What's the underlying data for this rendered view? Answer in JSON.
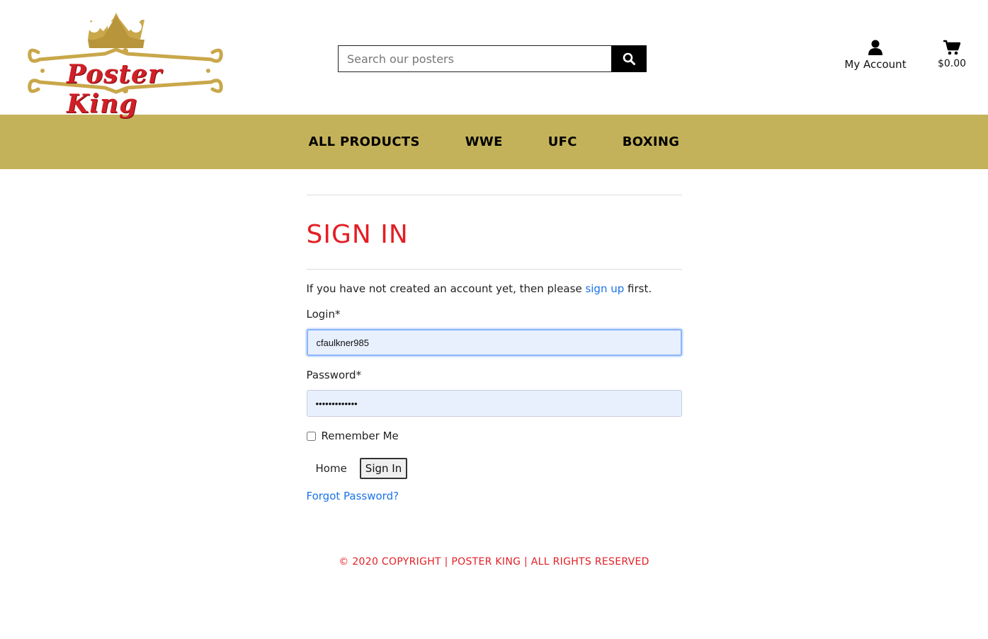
{
  "header": {
    "logo_text": "Poster King",
    "search_placeholder": "Search our posters",
    "account_label": "My Account",
    "cart_total": "$0.00"
  },
  "nav": {
    "items": [
      {
        "label": "ALL PRODUCTS"
      },
      {
        "label": "WWE"
      },
      {
        "label": "UFC"
      },
      {
        "label": "BOXING"
      }
    ]
  },
  "signin": {
    "title": "SIGN IN",
    "intro_before": "If you have not created an account yet, then please ",
    "signup_link": "sign up",
    "intro_after": " first.",
    "login_label": "Login*",
    "login_value": "cfaulkner985",
    "password_label": "Password*",
    "password_value": "•••••••••••••",
    "remember_label": "Remember Me",
    "home_label": "Home",
    "submit_label": "Sign In",
    "forgot_label": "Forgot Password?"
  },
  "footer": {
    "text": "© 2020 COPYRIGHT | POSTER KING | ALL RIGHTS RESERVED"
  },
  "colors": {
    "nav_bg": "#c4b25a",
    "title": "#e31e24",
    "link": "#1a73e8",
    "logo_gold": "#c9a74a",
    "logo_red": "#d11f26"
  }
}
